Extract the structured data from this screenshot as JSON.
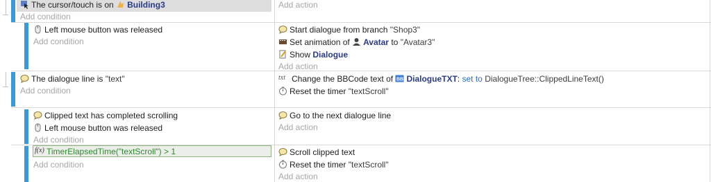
{
  "colors": {
    "event_bar": "#3a9ad9",
    "selected_bg": "#dedede",
    "expr": "#2c8a2c",
    "object": "#2a3a8a",
    "keyword": "#2a6fd0"
  },
  "add_condition": "Add condition",
  "add_action": "Add action",
  "events": [
    {
      "conditions": [
        {
          "icon": "cursor-on-object-icon",
          "prefix": "The cursor/touch is on",
          "object_icon": "sprite-object-icon",
          "object": "Building3"
        }
      ],
      "actions": []
    },
    {
      "conditions": [
        {
          "icon": "mouse-icon",
          "text": "Left mouse button was released"
        }
      ],
      "actions": [
        {
          "icon": "dialogue-icon",
          "text": "Start dialogue from branch",
          "arg": "\"Shop3\""
        },
        {
          "icon": "animation-icon",
          "prefix": "Set animation of",
          "object_icon": "avatar-object-icon",
          "object": "Avatar",
          "to": "to",
          "arg": "\"Avatar3\""
        },
        {
          "icon": "show-icon",
          "prefix": "Show",
          "object": "Dialogue"
        }
      ]
    },
    {
      "conditions": [
        {
          "icon": "dialogue-icon",
          "text": "The dialogue line is",
          "arg": "\"text\""
        }
      ],
      "actions": [
        {
          "icon": "text-icon",
          "icon_text": "txt",
          "prefix": "Change the BBCode text of",
          "object_icon": "bbtext-object-icon",
          "object": "DialogueTXT",
          "colon": ":",
          "keyword": "set to",
          "arg": "DialogueTree::ClippedLineText()"
        },
        {
          "icon": "timer-icon",
          "text": "Reset the timer",
          "arg": "\"textScroll\""
        }
      ]
    },
    {
      "conditions": [
        {
          "icon": "dialogue-icon",
          "text": "Clipped text has completed scrolling"
        },
        {
          "icon": "mouse-icon",
          "text": "Left mouse button was released"
        }
      ],
      "actions": [
        {
          "icon": "dialogue-icon",
          "text": "Go to the next dialogue line"
        }
      ]
    },
    {
      "conditions": [
        {
          "icon": "function-icon",
          "icon_text": "f(x)",
          "expr_text": "TimerElapsedTime(\"textScroll\")",
          "op": ">",
          "value": "1"
        }
      ],
      "actions": [
        {
          "icon": "dialogue-icon",
          "text": "Scroll clipped text"
        },
        {
          "icon": "timer-icon",
          "text": "Reset the timer",
          "arg": "\"textScroll\""
        }
      ]
    }
  ]
}
